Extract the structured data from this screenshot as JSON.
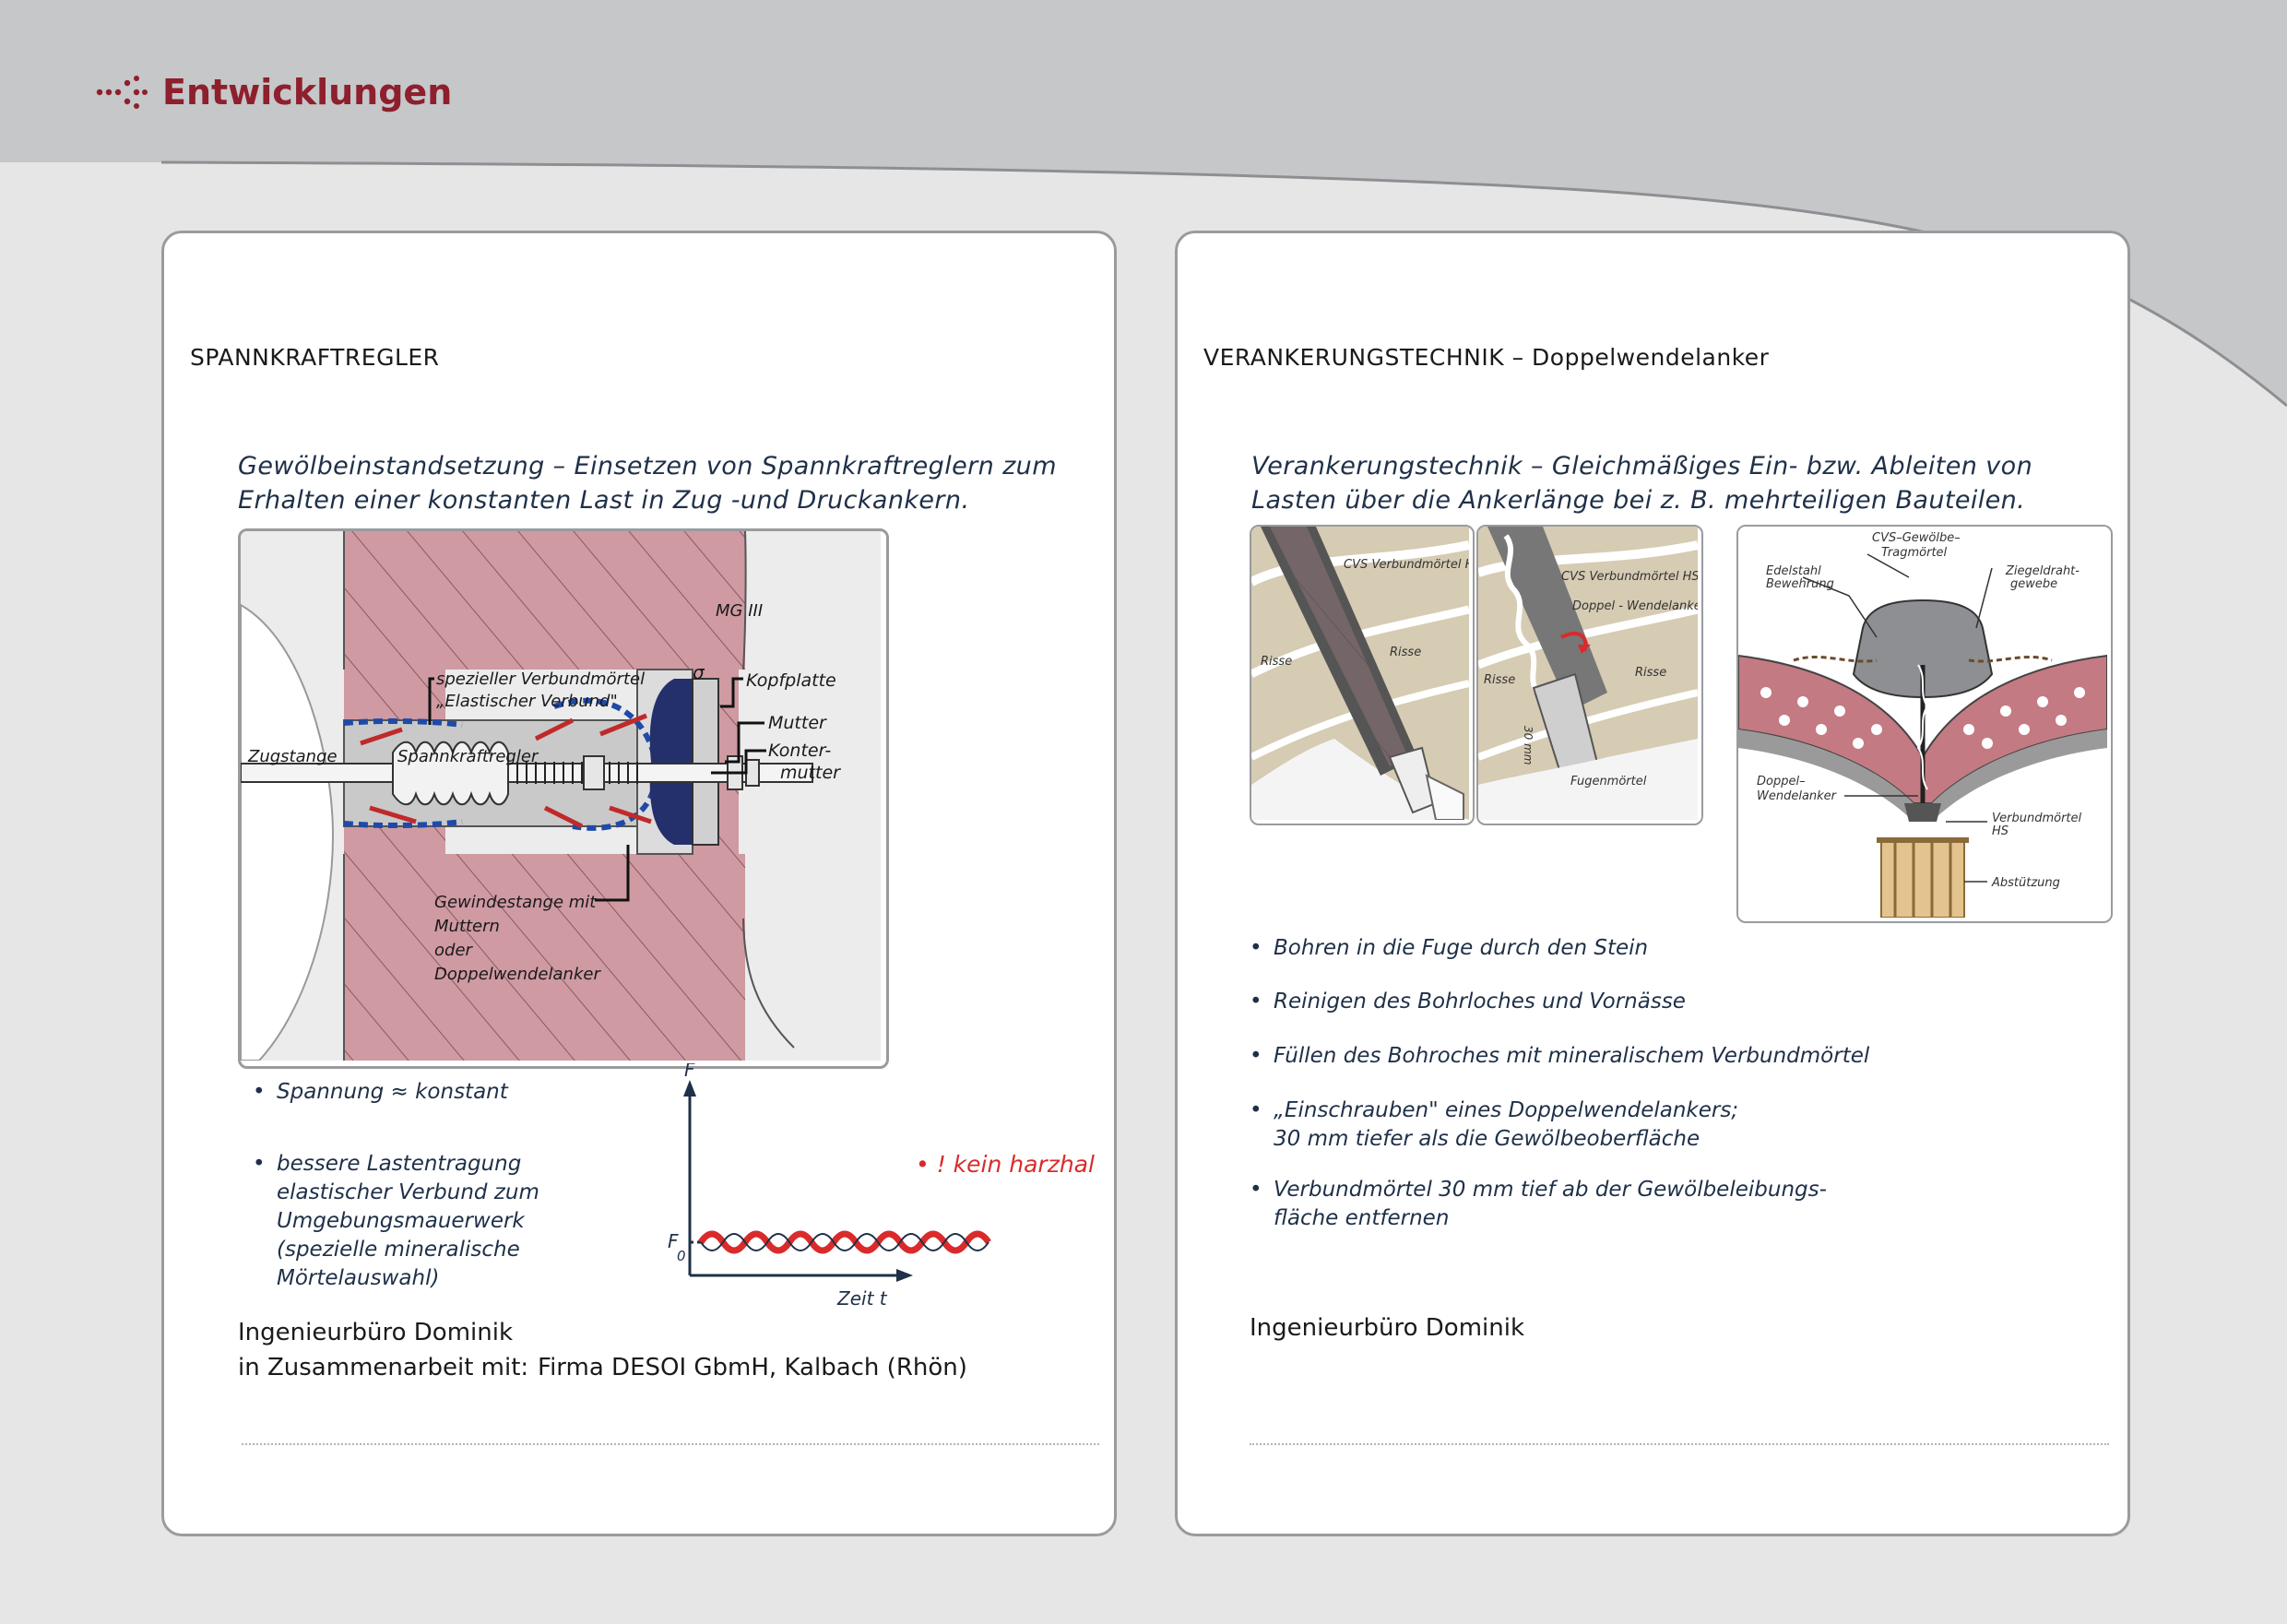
{
  "header": {
    "title": "Entwicklungen"
  },
  "colors": {
    "brand_red": "#8e1f2c",
    "text_navy": "#1f3048",
    "warning_red": "#d92b2b",
    "masonry_pink": "#cf9aa2",
    "card_border": "#9a9b9e"
  },
  "left_card": {
    "heading": "SPANNKRAFTREGLER",
    "intro": "Gewölbeinstandsetzung – Einsetzen von Spannkraftreglern zum Erhalten einer konstanten Last in Zug -und Druckankern.",
    "figure_labels": {
      "mg": "MG III",
      "sigma": "σ",
      "verbund_line1": "spezieller Verbundmörtel",
      "verbund_line2": "„Elastischer Verbund\"",
      "kopfplatte": "Kopfplatte",
      "mutter": "Mutter",
      "konter_line1": "Konter-",
      "konter_line2": "mutter",
      "zugstange": "Zugstange",
      "spannkraftregler": "Spannkraftregler",
      "gewinde_line1": "Gewindestange mit",
      "gewinde_line2": "Muttern",
      "gewinde_line3": "oder",
      "gewinde_line4": "Doppelwendelanker"
    },
    "bullets": [
      "Spannung ≈ konstant",
      "bessere Lastentragung\n elastischer Verbund zum\n Umgebungsmauerwerk\n(spezielle mineralische\n Mörtelauswahl)"
    ],
    "warning": "• ! kein harzhaltiger Mörtel !",
    "graph": {
      "y_axis": "F",
      "f0": "F",
      "f0_sub": "0",
      "x_axis": "Zeit  t"
    },
    "credit_line1": "Ingenieurbüro Dominik",
    "credit_line2": "in Zusammenarbeit mit:",
    "credit_partner": "Firma DESOI GbmH, Kalbach (Rhön)"
  },
  "right_card": {
    "heading": "VERANKERUNGSTECHNIK – Doppelwendelanker",
    "intro": "Verankerungstechnik – Gleichmäßiges Ein- bzw. Ableiten von Lasten über die Ankerlänge bei z. B. mehrteiligen Bauteilen.",
    "fig1_labels": {
      "cvs": "CVS Verbundmörtel HS",
      "risse_a": "Risse",
      "risse_b": "Risse"
    },
    "fig2_labels": {
      "cvs": "CVS Verbundmörtel HS",
      "doppel": "Doppel - Wendelanker",
      "risse_a": "Risse",
      "risse_b": "Risse",
      "mm": "30 mm",
      "fugen": "Fugenmörtel"
    },
    "fig3_labels": {
      "cvs_line1": "CVS–Gewölbe–",
      "cvs_line2": "Tragmörtel",
      "edel_line1": "Edelstahl",
      "edel_line2": "Bewehrung",
      "ziegel_line1": "Ziegeldraht-",
      "ziegel_line2": "gewebe",
      "doppel_line1": "Doppel–",
      "doppel_line2": "Wendelanker",
      "verbund_line1": "Verbundmörtel",
      "verbund_line2": "HS",
      "abst": "Abstützung"
    },
    "bullets": [
      "Bohren in die Fuge durch den Stein",
      "Reinigen des Bohrloches und Vornässe",
      "Füllen des Bohroches mit mineralischem Verbundmörtel",
      "„Einschrauben\" eines Doppelwendelankers;\n30 mm tiefer als die Gewölbeoberfläche",
      "Verbundmörtel 30 mm tief ab der Gewölbeleibungs-\nfläche entfernen"
    ],
    "credit": "Ingenieurbüro Dominik"
  }
}
